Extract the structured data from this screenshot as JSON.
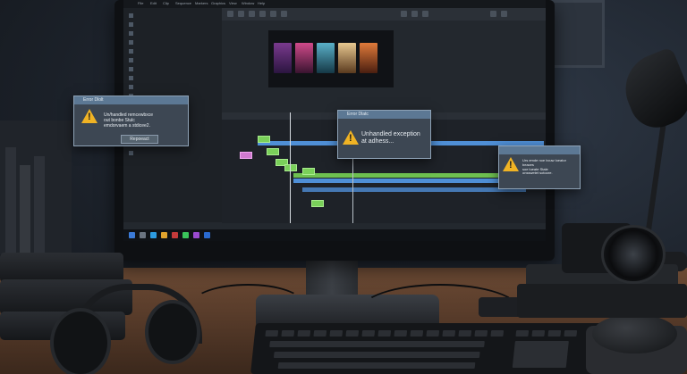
{
  "editor": {
    "menu": [
      "File",
      "Edit",
      "Clip",
      "Sequence",
      "Markers",
      "Graphics",
      "View",
      "Window",
      "Help"
    ],
    "panel_items": [
      "",
      "",
      "",
      "",
      "",
      "",
      "",
      "",
      "",
      "",
      "",
      "",
      "",
      "",
      "",
      "",
      "",
      "",
      "",
      ""
    ]
  },
  "dialogs": [
    {
      "title": "Error Dlolt",
      "message": "Un/handled remcewbxce\nout bonbe Stulc\nemdorvaem a stdicee2.",
      "button": "Repoeact"
    },
    {
      "title": "Error Dlatc",
      "message": "Unhandled exception\nat adhess..."
    },
    {
      "title": "",
      "message": "Urs emde noe bcuw loeator beaces\nsoe lueate Stale\nonsswetet sotoore."
    }
  ],
  "colors": {
    "dialog_title": "#5c7894",
    "dialog_body": "#3d4753",
    "warning": "#f0b324",
    "timeline_clip": "#7ad05a",
    "timeline_track": "#4f8fd6"
  },
  "icons": [
    "warning-icon",
    "play-icon",
    "cut-icon",
    "folder-icon",
    "camera",
    "headphones",
    "desk-lamp"
  ]
}
